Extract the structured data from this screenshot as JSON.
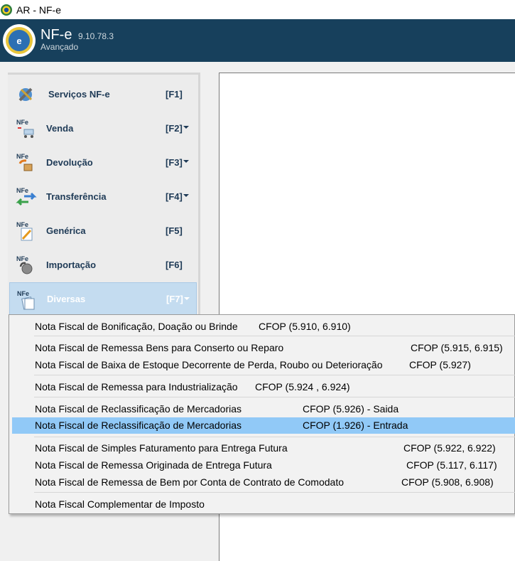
{
  "window": {
    "title": "AR - NF-e"
  },
  "header": {
    "brand": "NF-e",
    "version": "9.10.78.3",
    "edition": "Avançado"
  },
  "sidebar": {
    "items": [
      {
        "label": "Serviços NF-e",
        "key": "[F1]",
        "has_menu": false,
        "icon": "services-icon"
      },
      {
        "label": "Venda",
        "key": "[F2]",
        "has_menu": true,
        "icon": "nfe-cart-icon"
      },
      {
        "label": "Devolução",
        "key": "[F3]",
        "has_menu": true,
        "icon": "nfe-return-icon"
      },
      {
        "label": "Transferência",
        "key": "[F4]",
        "has_menu": true,
        "icon": "nfe-transfer-icon"
      },
      {
        "label": "Genérica",
        "key": "[F5]",
        "has_menu": false,
        "icon": "nfe-edit-icon"
      },
      {
        "label": "Importação",
        "key": "[F6]",
        "has_menu": false,
        "icon": "nfe-import-icon"
      },
      {
        "label": "Diversas",
        "key": "[F7]",
        "has_menu": true,
        "icon": "nfe-misc-icon",
        "active": true
      }
    ]
  },
  "menu": {
    "items": [
      {
        "name": "Nota Fiscal de Bonificação, Doação ou Brinde",
        "cfop": "CFOP (5.910, 6.910)"
      },
      {
        "name": "Nota Fiscal de Remessa Bens para Conserto ou Reparo",
        "cfop": "CFOP (5.915, 6.915)"
      },
      {
        "name": "Nota Fiscal de Baixa de Estoque Decorrente de Perda, Roubo ou Deterioração",
        "cfop": "CFOP (5.927)"
      },
      {
        "name": "Nota Fiscal de Remessa para Industrialização",
        "cfop": "CFOP (5.924 , 6.924)"
      },
      {
        "name": "Nota Fiscal de Reclassificação de Mercadorias",
        "cfop": "CFOP (5.926) - Saida"
      },
      {
        "name": "Nota Fiscal de Reclassificação de Mercadorias",
        "cfop": "CFOP (1.926) - Entrada",
        "highlighted": true
      },
      {
        "name": "Nota Fiscal de Simples Faturamento para Entrega Futura",
        "cfop": "CFOP (5.922, 6.922)"
      },
      {
        "name": "Nota Fiscal de Remessa Originada de Entrega Futura",
        "cfop": "CFOP (5.117, 6.117)"
      },
      {
        "name": "Nota Fiscal de Remessa de Bem por Conta de Contrato de Comodato",
        "cfop": "CFOP (5.908, 6.908)"
      },
      {
        "name": "Nota Fiscal Complementar de Imposto",
        "cfop": ""
      }
    ]
  },
  "colors": {
    "header_bg": "#17405c",
    "highlight": "#91c9f7",
    "active_item": "#c4dcf0"
  }
}
